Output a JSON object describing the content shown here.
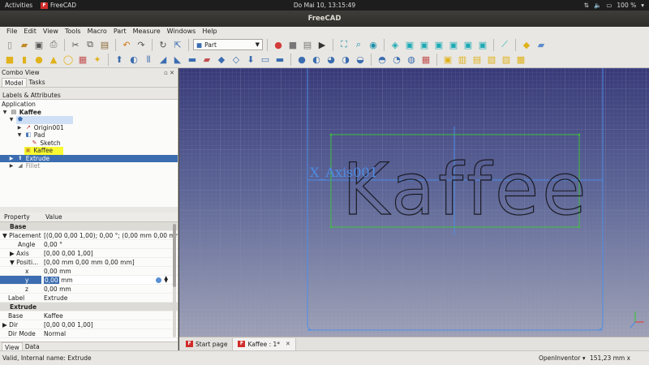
{
  "system_bar": {
    "activities": "Activities",
    "app_name": "FreeCAD",
    "clock": "Do Mai 10, 13:15:49",
    "battery": "100 %"
  },
  "window": {
    "title": "FreeCAD"
  },
  "menu": [
    "File",
    "Edit",
    "View",
    "Tools",
    "Macro",
    "Part",
    "Measure",
    "Windows",
    "Help"
  ],
  "toolbar": {
    "workbench": "Part"
  },
  "combo_view": {
    "title": "Combo View",
    "tabs": [
      "Model",
      "Tasks"
    ],
    "active_tab": "Model",
    "section": "Labels & Attributes",
    "tree_root": "Application",
    "tree": [
      {
        "label": "Kaffee",
        "icon": "document-icon"
      },
      {
        "label": "",
        "icon": "body-icon"
      },
      {
        "label": "Origin001",
        "icon": "origin-icon"
      },
      {
        "label": "Pad",
        "icon": "pad-icon"
      },
      {
        "label": "Sketch",
        "icon": "sketch-icon"
      },
      {
        "label": "Kaffee",
        "icon": "shapestring-icon"
      },
      {
        "label": "Extrude",
        "icon": "extrude-icon"
      },
      {
        "label": "Fillet",
        "icon": "fillet-icon"
      }
    ]
  },
  "properties": {
    "headers": [
      "Property",
      "Value"
    ],
    "rows": [
      {
        "name": "Base",
        "value": "",
        "group": true
      },
      {
        "name": "Placement",
        "value": "[(0,00 0,00 1,00); 0,00 °; (0,00 mm  0,00 mm  ..."
      },
      {
        "name": "Angle",
        "value": "0,00 °"
      },
      {
        "name": "Axis",
        "value": "[0,00 0,00 1,00]"
      },
      {
        "name": "Positi...",
        "value": "[0,00 mm  0,00 mm  0,00 mm]"
      },
      {
        "name": "x",
        "value": "0,00 mm"
      },
      {
        "name": "y",
        "value_selected": "0,00",
        "value_unit": " mm"
      },
      {
        "name": "z",
        "value": "0,00 mm"
      },
      {
        "name": "Label",
        "value": "Extrude"
      },
      {
        "name": "Extrude",
        "value": "",
        "group": true
      },
      {
        "name": "Base",
        "value": "Kaffee"
      },
      {
        "name": "Dir",
        "value": "[0,00 0,00 1,00]"
      },
      {
        "name": "Dir Mode",
        "value": "Normal"
      }
    ],
    "bottom_tabs": [
      "View",
      "Data"
    ]
  },
  "viewport": {
    "text_3d": "Kaffee",
    "axis_label": "X_Axis001"
  },
  "doc_tabs": [
    {
      "label": "Start page",
      "active": false
    },
    {
      "label": "Kaffee : 1*",
      "active": true
    }
  ],
  "status": {
    "message": "Valid, Internal name: Extrude",
    "navigation": "OpenInventor",
    "dimensions": "151,23 mm x 86,62 mm"
  }
}
